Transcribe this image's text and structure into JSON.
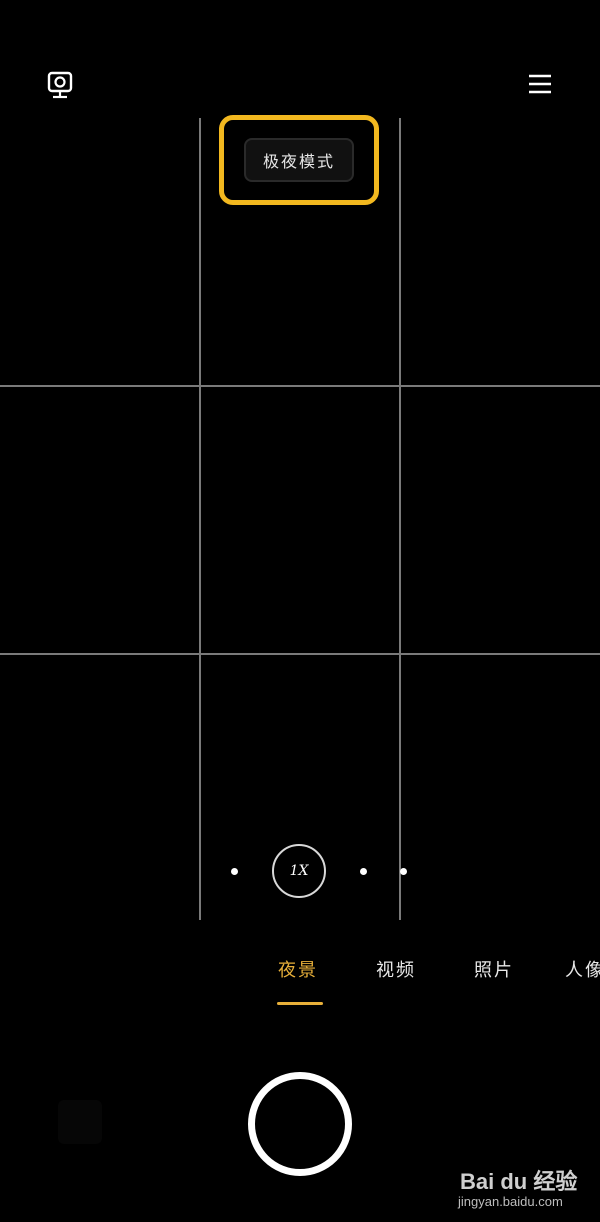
{
  "top_bar": {
    "camera_switch_icon": "camera-flip-icon",
    "menu_icon": "hamburger-menu-icon"
  },
  "mode_badge": {
    "label": "极夜模式",
    "highlight_color": "#f2b81f"
  },
  "zoom": {
    "label": "1X"
  },
  "tabs": [
    {
      "label": "夜景",
      "active": true
    },
    {
      "label": "视频",
      "active": false
    },
    {
      "label": "照片",
      "active": false
    },
    {
      "label": "人像",
      "active": false
    }
  ],
  "accent_color": "#e8b03a",
  "watermark": {
    "brand": "Bai  du 经验",
    "url": "jingyan.baidu.com"
  }
}
